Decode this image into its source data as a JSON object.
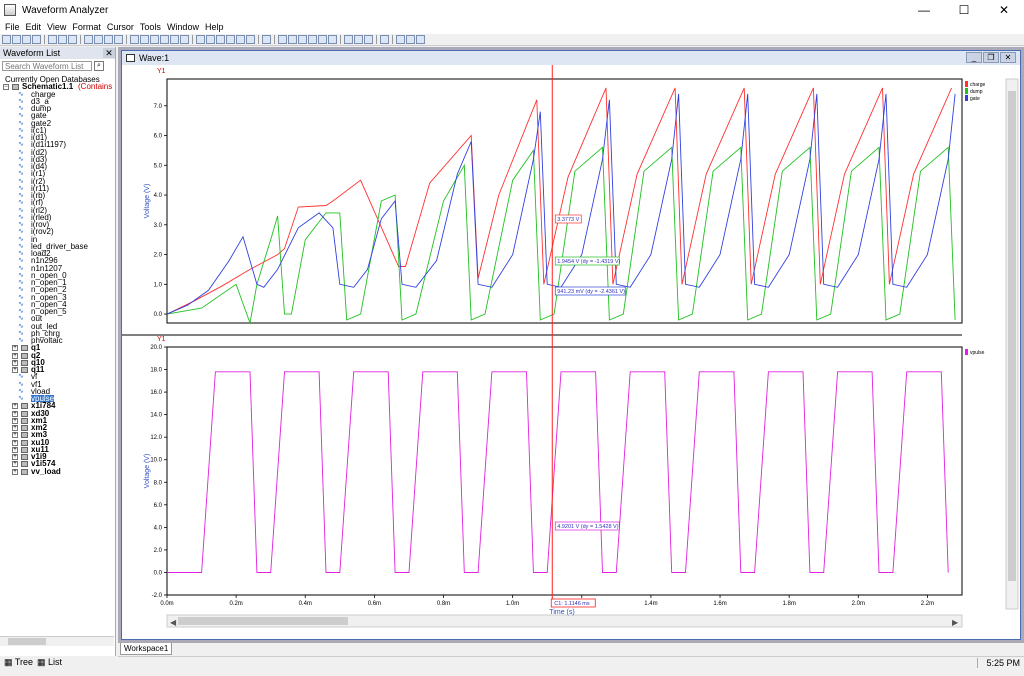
{
  "window": {
    "title": "Waveform Analyzer",
    "minimize": "—",
    "maximize": "☐",
    "close": "✕"
  },
  "menu": [
    "File",
    "Edit",
    "View",
    "Format",
    "Cursor",
    "Tools",
    "Window",
    "Help"
  ],
  "left_panel": {
    "title": "Waveform List",
    "close": "✕",
    "search_placeholder": "Search Waveform List",
    "section": "Currently Open Databases",
    "database": "Schematic1.1",
    "database_note": "(Contains un",
    "waveforms": [
      "charge",
      "d3_a",
      "dump",
      "gate",
      "gate2",
      "i(c1)",
      "i(d1)",
      "i(d1i1197)",
      "i(d2)",
      "i(d3)",
      "i(d4)",
      "i(r1)",
      "i(r2)",
      "i(r11)",
      "i(rb)",
      "i(rf)",
      "i(rl2)",
      "i(rled)",
      "i(rov)",
      "i(rov2)",
      "in",
      "led_driver_base",
      "load2",
      "n1n296",
      "n1n1207",
      "n_open_0",
      "n_open_1",
      "n_open_2",
      "n_open_3",
      "n_open_4",
      "n_open_5",
      "out",
      "out_led",
      "ph_chrg",
      "phvoltaic"
    ],
    "groups_a": [
      "q1",
      "q2",
      "q10",
      "q11"
    ],
    "waveforms_b": [
      "vf",
      "vf1",
      "vload",
      "vpulse"
    ],
    "selected": "vpulse",
    "groups_b": [
      "x1i784",
      "xd30",
      "xm1",
      "xm2",
      "xm3",
      "xu10",
      "xu11",
      "v1i9",
      "v1i574",
      "vv_load"
    ],
    "tabs": [
      "Tree",
      "List"
    ]
  },
  "wave_window": {
    "title": "Wave:1",
    "workspace_tab": "Workspace1"
  },
  "status": {
    "clock": "5:25 PM"
  },
  "chart_data": [
    {
      "type": "line",
      "title": "",
      "panel_label": "Y1",
      "ylabel": "Voltage (V)",
      "xlabel": "Time (s)",
      "xlim": [
        0,
        2.3
      ],
      "ylim": [
        -0.3,
        7.9
      ],
      "x_unit": "m",
      "yticks": [
        -0.0,
        1.0,
        2.0,
        3.0,
        4.0,
        5.0,
        6.0,
        7.0
      ],
      "ytick_labels": [
        "0.0",
        "1.0",
        "2.0",
        "3.0",
        "4.0",
        "5.0",
        "6.0",
        "7.0"
      ],
      "legend": [
        {
          "name": "charge",
          "color": "#ff3030"
        },
        {
          "name": "dump",
          "color": "#20c020"
        },
        {
          "name": "gate",
          "color": "#3040e0"
        }
      ],
      "series": [
        {
          "name": "charge",
          "color": "#ff3030",
          "x": [
            0,
            0.08,
            0.16,
            0.24,
            0.32,
            0.34,
            0.38,
            0.46,
            0.48,
            0.56,
            0.67,
            0.69,
            0.76,
            0.88,
            0.9,
            0.96,
            1.07,
            1.09,
            1.16,
            1.27,
            1.29,
            1.36,
            1.47,
            1.49,
            1.56,
            1.67,
            1.69,
            1.76,
            1.87,
            1.89,
            1.96,
            2.07,
            2.09,
            2.16,
            2.27
          ],
          "y": [
            0,
            0.45,
            0.95,
            1.5,
            2.0,
            2.2,
            3.6,
            3.65,
            3.8,
            4.5,
            1.6,
            1.6,
            4.4,
            6.0,
            1.2,
            4.0,
            7.2,
            1.0,
            4.6,
            7.6,
            1.0,
            4.7,
            7.6,
            1.0,
            4.7,
            7.6,
            1.0,
            4.7,
            7.6,
            1.0,
            4.7,
            7.6,
            1.0,
            4.7,
            7.6
          ]
        },
        {
          "name": "dump",
          "color": "#20c020",
          "x": [
            0,
            0.1,
            0.2,
            0.24,
            0.26,
            0.3,
            0.32,
            0.34,
            0.36,
            0.4,
            0.46,
            0.5,
            0.52,
            0.56,
            0.62,
            0.66,
            0.68,
            0.72,
            0.8,
            0.86,
            0.88,
            0.92,
            1.0,
            1.06,
            1.08,
            1.12,
            1.18,
            1.26,
            1.28,
            1.32,
            1.38,
            1.46,
            1.48,
            1.52,
            1.58,
            1.66,
            1.68,
            1.72,
            1.78,
            1.86,
            1.88,
            1.92,
            1.98,
            2.06,
            2.08,
            2.12,
            2.18,
            2.26,
            2.28
          ],
          "y": [
            0,
            0.2,
            1.0,
            -0.3,
            1.0,
            2.5,
            3.3,
            0,
            0,
            2.5,
            3.4,
            3.4,
            -0.2,
            0,
            3.8,
            4.0,
            -0.2,
            0,
            3.8,
            5.0,
            -0.2,
            0,
            4.5,
            5.5,
            -0.2,
            0,
            4.8,
            5.6,
            -0.2,
            0,
            4.8,
            5.6,
            -0.2,
            0,
            4.8,
            5.6,
            -0.2,
            0,
            4.8,
            5.6,
            -0.2,
            0,
            4.8,
            5.6,
            -0.2,
            0,
            4.8,
            5.6,
            -0.2
          ]
        },
        {
          "name": "gate",
          "color": "#3040e0",
          "x": [
            0,
            0.06,
            0.12,
            0.18,
            0.22,
            0.26,
            0.28,
            0.32,
            0.38,
            0.44,
            0.48,
            0.5,
            0.54,
            0.58,
            0.62,
            0.66,
            0.68,
            0.72,
            0.78,
            0.84,
            0.88,
            0.9,
            0.94,
            1.0,
            1.06,
            1.08,
            1.1,
            1.14,
            1.2,
            1.26,
            1.28,
            1.3,
            1.34,
            1.4,
            1.46,
            1.48,
            1.5,
            1.54,
            1.6,
            1.66,
            1.68,
            1.7,
            1.74,
            1.8,
            1.86,
            1.88,
            1.9,
            1.94,
            2.0,
            2.06,
            2.08,
            2.1,
            2.14,
            2.2,
            2.26,
            2.28
          ],
          "y": [
            0,
            0.3,
            0.8,
            1.8,
            2.6,
            1.0,
            0.9,
            1.5,
            2.9,
            3.4,
            2.9,
            1.0,
            0.9,
            1.5,
            3.2,
            3.8,
            1.0,
            0.9,
            1.8,
            4.7,
            5.8,
            1.0,
            0.9,
            2.0,
            5.2,
            6.8,
            1.0,
            0.9,
            2.0,
            5.2,
            7.2,
            1.0,
            0.9,
            2.0,
            5.2,
            7.4,
            1.0,
            0.9,
            2.0,
            5.2,
            7.4,
            1.0,
            0.9,
            2.0,
            5.2,
            7.4,
            1.0,
            0.9,
            2.0,
            5.2,
            7.4,
            1.0,
            0.9,
            2.0,
            5.2,
            7.4
          ]
        }
      ],
      "cursor_labels": [
        "3.3773 V",
        "1.9454 V (dy = -1.4319 V)",
        "941.23 mV (dy = -2.4361 V)"
      ]
    },
    {
      "type": "line",
      "title": "",
      "panel_label": "Y1",
      "ylabel": "Voltage (V)",
      "xlabel": "Time (s)",
      "xlim": [
        0,
        2.3
      ],
      "ylim": [
        -2.0,
        20.0
      ],
      "x_unit": "m",
      "yticks": [
        -2.0,
        0.0,
        2.0,
        4.0,
        6.0,
        8.0,
        10.0,
        12.0,
        14.0,
        16.0,
        18.0,
        20.0
      ],
      "ytick_labels": [
        "-2.0",
        "0.0",
        "2.0",
        "4.0",
        "6.0",
        "8.0",
        "10.0",
        "12.0",
        "14.0",
        "16.0",
        "18.0",
        "20.0"
      ],
      "xticks": [
        0,
        0.2,
        0.4,
        0.6,
        0.8,
        1.0,
        1.2,
        1.4,
        1.6,
        1.8,
        2.0,
        2.2
      ],
      "xtick_labels": [
        "0.0m",
        "0.2m",
        "0.4m",
        "0.6m",
        "0.8m",
        "1.0m",
        "1.2m",
        "1.4m",
        "1.6m",
        "1.8m",
        "2.0m",
        "2.2m"
      ],
      "legend": [
        {
          "name": "vpulse",
          "color": "#e020e0"
        }
      ],
      "series": [
        {
          "name": "vpulse",
          "color": "#e020e0",
          "x": [
            0,
            0.1,
            0.14,
            0.24,
            0.26,
            0.3,
            0.34,
            0.44,
            0.46,
            0.5,
            0.54,
            0.64,
            0.66,
            0.7,
            0.74,
            0.84,
            0.86,
            0.9,
            0.94,
            1.04,
            1.06,
            1.1,
            1.14,
            1.24,
            1.26,
            1.3,
            1.34,
            1.44,
            1.46,
            1.5,
            1.54,
            1.64,
            1.66,
            1.7,
            1.74,
            1.84,
            1.86,
            1.9,
            1.94,
            2.04,
            2.06,
            2.1,
            2.14,
            2.24,
            2.26
          ],
          "y": [
            0,
            0,
            17.8,
            17.8,
            0,
            0,
            17.8,
            17.8,
            0,
            0,
            17.8,
            17.8,
            0,
            0,
            17.8,
            17.8,
            0,
            0,
            17.8,
            17.8,
            0,
            0,
            17.8,
            17.8,
            0,
            0,
            17.8,
            17.8,
            0,
            0,
            17.8,
            17.8,
            0,
            0,
            17.8,
            17.8,
            0,
            0,
            17.8,
            17.8,
            0,
            0,
            17.8,
            17.8,
            0
          ]
        }
      ],
      "cursor_labels": [
        "4.9201 V (dy = 1.5428 V)"
      ],
      "cursor_x": 1.1146,
      "cursor_readout": "C1: 1.1146 ms"
    }
  ]
}
